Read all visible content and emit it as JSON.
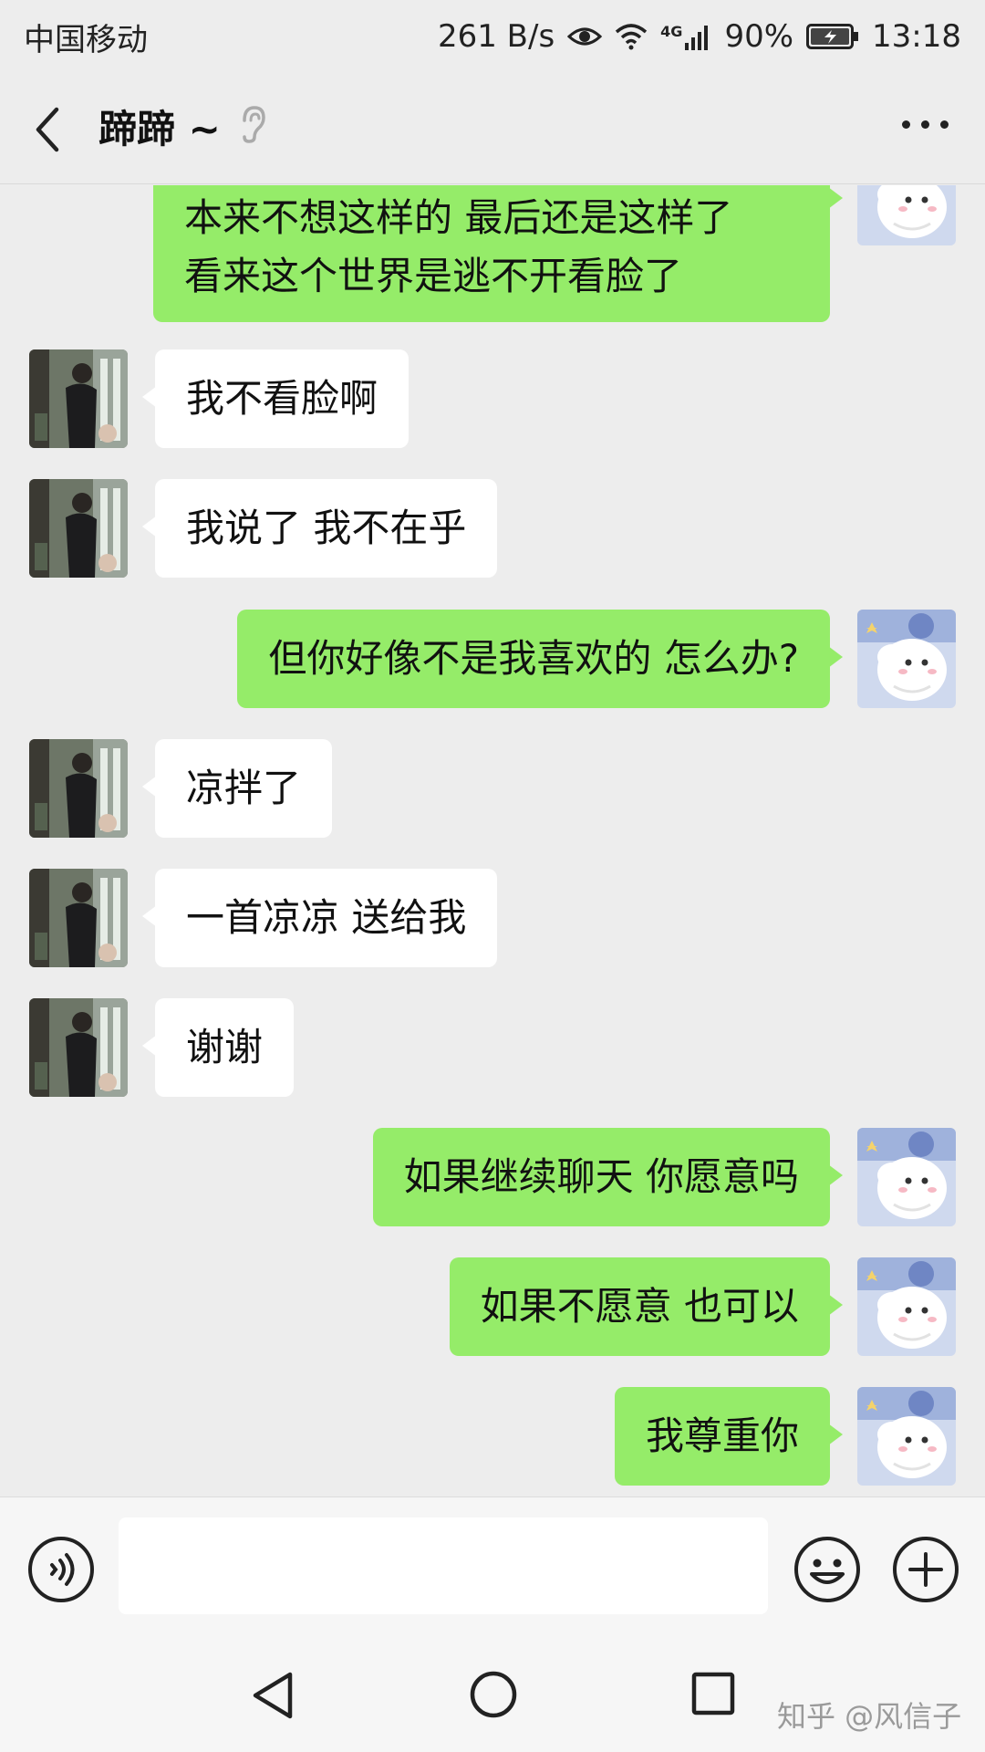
{
  "status_bar": {
    "carrier": "中国移动",
    "net_speed": "261 B/s",
    "network": "4G",
    "battery": "90%",
    "time": "13:18"
  },
  "header": {
    "contact_name": "蹄蹄 ~"
  },
  "messages": [
    {
      "side": "me",
      "lines": [
        "本来不想这样的 最后还是这样了",
        "看来这个世界是逃不开看脸了"
      ]
    },
    {
      "side": "them",
      "text": "我不看脸啊"
    },
    {
      "side": "them",
      "text": "我说了 我不在乎"
    },
    {
      "side": "me",
      "text": "但你好像不是我喜欢的 怎么办?"
    },
    {
      "side": "them",
      "text": "凉拌了"
    },
    {
      "side": "them",
      "text": "一首凉凉 送给我"
    },
    {
      "side": "them",
      "text": "谢谢"
    },
    {
      "side": "me",
      "text": "如果继续聊天 你愿意吗"
    },
    {
      "side": "me",
      "text": "如果不愿意 也可以"
    },
    {
      "side": "me",
      "text": "我尊重你"
    }
  ],
  "input": {
    "value": ""
  },
  "watermark": "知乎 @风信子",
  "colors": {
    "me_bubble": "#95ec69",
    "them_bubble": "#ffffff",
    "background": "#ededed"
  }
}
